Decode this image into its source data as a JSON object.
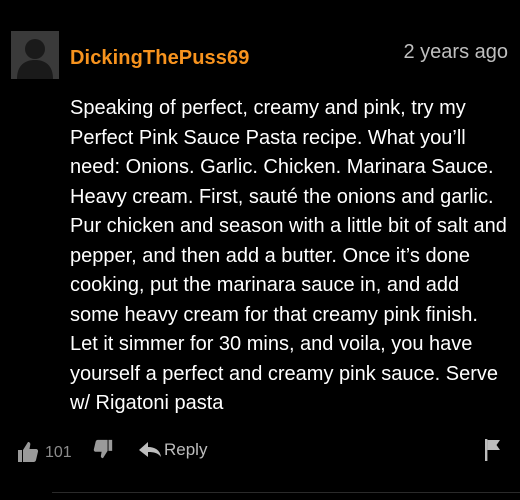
{
  "comment": {
    "username": "DickingThePuss69",
    "timestamp": "2 years ago",
    "body": "Speaking of perfect, creamy and pink, try my Perfect Pink Sauce Pasta recipe. What you’ll need: Onions. Garlic. Chicken. Marinara Sauce. Heavy cream. First, sauté the onions and garlic. Pur chicken and season with a little bit of salt and pepper, and then add a butter. Once it’s done cooking, put the marinara sauce in, and add some heavy cream for that creamy pink finish. Let it simmer for 30 mins, and voila, you have yourself a perfect and creamy pink sauce. Serve w/ Rigatoni pasta",
    "likes": "101",
    "reply_label": "Reply"
  },
  "icons": {
    "like": "thumbs-up-icon",
    "dislike": "thumbs-down-icon",
    "reply": "reply-arrow-icon",
    "flag": "flag-icon",
    "avatar": "default-user-avatar"
  },
  "colors": {
    "background": "#000000",
    "username": "#f7931e",
    "body_text": "#ffffff",
    "timestamp": "#bfbfbf",
    "muted": "#8c8c8c"
  }
}
